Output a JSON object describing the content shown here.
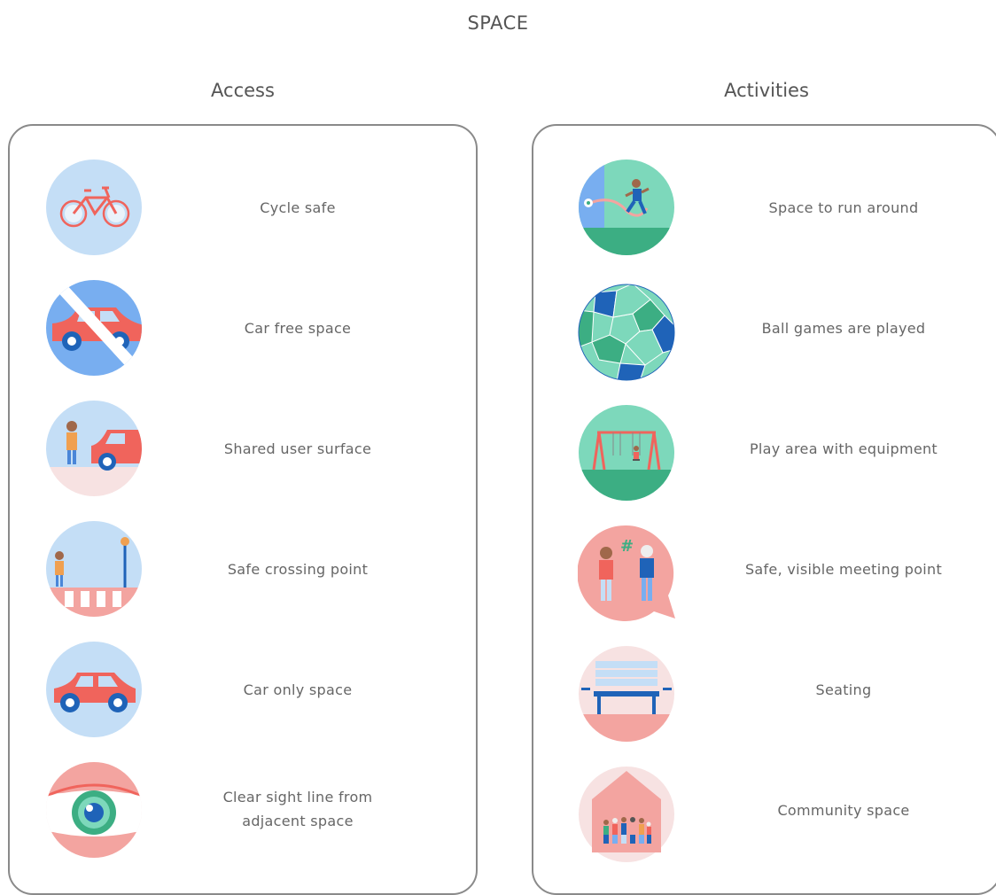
{
  "title": "SPACE",
  "access": {
    "heading": "Access",
    "items": [
      {
        "label": "Cycle safe",
        "icon": "bicycle-icon"
      },
      {
        "label": "Car free space",
        "icon": "no-car-icon"
      },
      {
        "label": "Shared user surface",
        "icon": "shared-surface-icon"
      },
      {
        "label": "Safe crossing point",
        "icon": "crossing-icon"
      },
      {
        "label": "Car only space",
        "icon": "car-icon"
      },
      {
        "label": "Clear sight line from adjacent space",
        "icon": "eye-icon"
      }
    ]
  },
  "activities": {
    "heading": "Activities",
    "items": [
      {
        "label": "Space to run around",
        "icon": "running-child-icon"
      },
      {
        "label": "Ball games are played",
        "icon": "football-icon"
      },
      {
        "label": "Play area with equipment",
        "icon": "swing-icon"
      },
      {
        "label": "Safe, visible meeting point",
        "icon": "meeting-point-icon"
      },
      {
        "label": "Seating",
        "icon": "bench-icon"
      },
      {
        "label": "Community space",
        "icon": "community-house-icon"
      }
    ]
  },
  "colors": {
    "light_blue": "#c4def6",
    "mid_blue": "#78aef0",
    "coral": "#f0645c",
    "pink": "#f3a4a0",
    "light_pink": "#f7e2e2",
    "teal": "#7dd8bb",
    "green": "#3cae83",
    "dark_blue": "#1f63b8"
  }
}
